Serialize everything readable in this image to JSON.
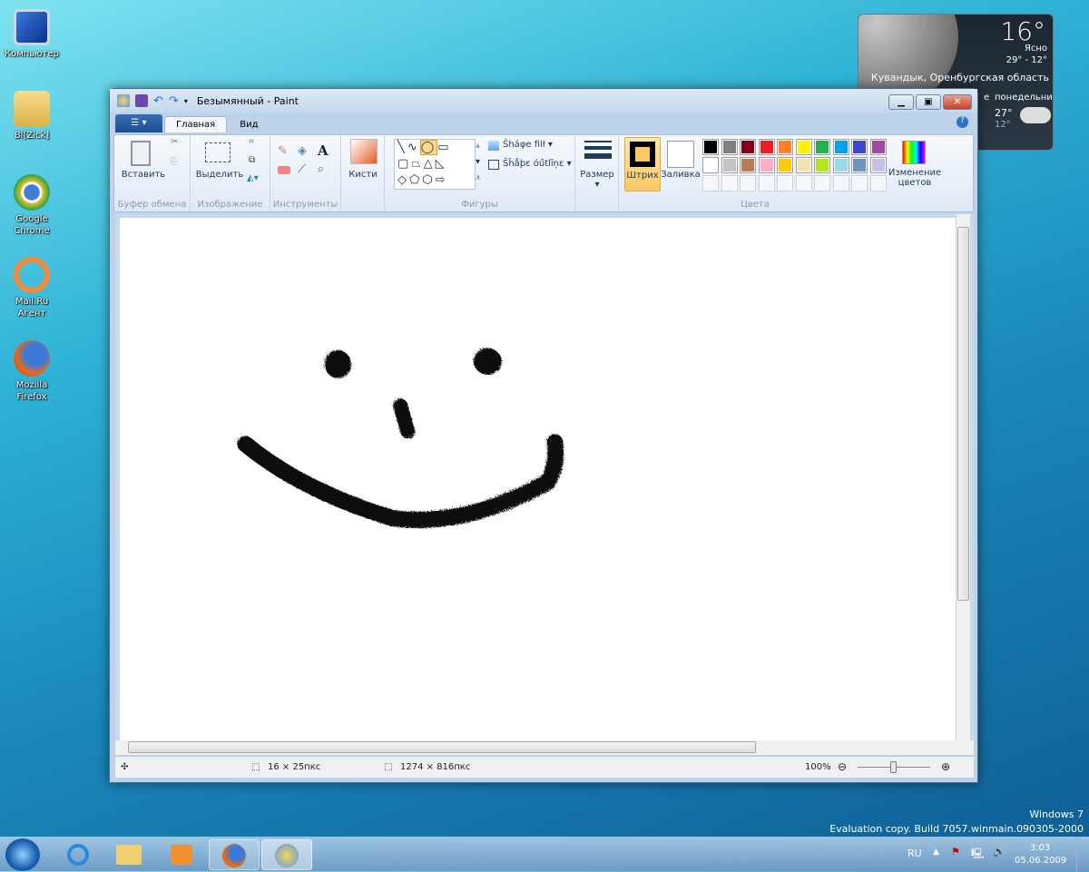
{
  "desktop": {
    "icons": [
      {
        "label": "Компьютер"
      },
      {
        "label": "Bl[Zick]"
      },
      {
        "label": "Google Chrome"
      },
      {
        "label": "Mail.Ru Агент"
      },
      {
        "label": "Mozilla Firefox"
      }
    ]
  },
  "weather": {
    "temp": "16°",
    "condition": "Ясно",
    "range": "29°  -  12°",
    "location": "Кувандык, Оренбургская область",
    "partial_day": "е",
    "day": "понедельник",
    "high": "27°",
    "low": "12°"
  },
  "paint": {
    "title": "Безымянный - Paint",
    "tabs": [
      {
        "label": "Главная",
        "active": true
      },
      {
        "label": "Вид",
        "active": false
      }
    ],
    "groups": {
      "clipboard": "Буфер обмена",
      "image": "Изображение",
      "tools": "Инструменты",
      "shapes": "Фигуры",
      "colors": "Цвета"
    },
    "buttons": {
      "paste": "Вставить",
      "select": "Выделить",
      "brushes": "Кисти",
      "shape_fill": "Ŝháφe filł",
      "shape_outline": "Ŝĥåþε óú̈tlīņε",
      "size": "Размер",
      "color1": "Штрих",
      "color2": "Заливка",
      "edit_colors": "Изменение цветов"
    },
    "color1": "#000000",
    "color2": "#ffffff",
    "palette": [
      "#000000",
      "#7f7f7f",
      "#880015",
      "#ed1c24",
      "#ff7f27",
      "#fff200",
      "#22b14c",
      "#00a2e8",
      "#3f48cc",
      "#a349a4",
      "#ffffff",
      "#c3c3c3",
      "#b97a57",
      "#ffaec9",
      "#ffc90e",
      "#efe4b0",
      "#b5e61d",
      "#99d9ea",
      "#7092be",
      "#c8bfe7"
    ],
    "status": {
      "selection": "16 × 25пкс",
      "canvas_size": "1274 × 816пкс",
      "zoom": "100%",
      "zoom_level": 0.5
    }
  },
  "watermark": {
    "line1": "Windows 7",
    "line2": "Evaluation copy. Build 7057.winmain.090305-2000"
  },
  "tray": {
    "lang": "RU",
    "time": "3:03",
    "date": "05.06.2009"
  }
}
